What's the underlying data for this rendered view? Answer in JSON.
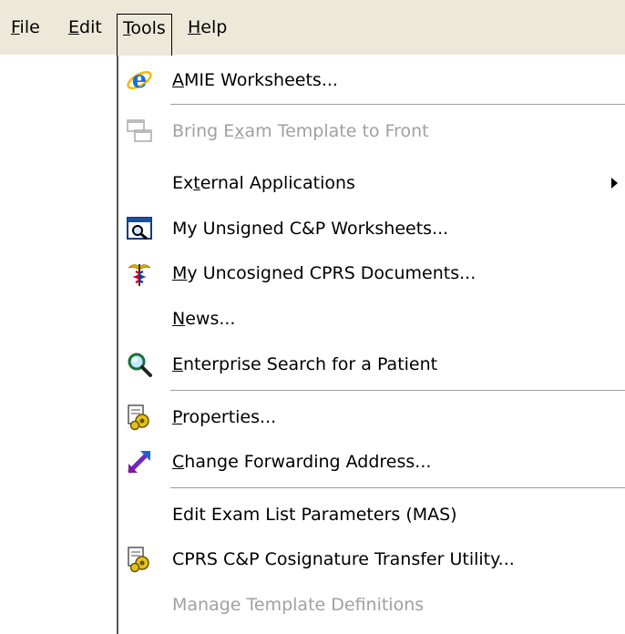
{
  "menubar": {
    "file": {
      "mnemonic": "F",
      "rest": "ile"
    },
    "edit": {
      "mnemonic": "E",
      "rest": "dit"
    },
    "tools": {
      "mnemonic": "T",
      "rest": "ools"
    },
    "help": {
      "mnemonic": "H",
      "rest": "elp"
    }
  },
  "tools_menu": {
    "items": [
      {
        "pre": "",
        "mnemonic": "A",
        "post": "MIE Worksheets...",
        "icon": "ie-icon",
        "enabled": true
      },
      {
        "pre": "Bring E",
        "mnemonic": "x",
        "post": "am Template to Front",
        "icon": "windows-icon",
        "enabled": false
      },
      {
        "pre": "Ex",
        "mnemonic": "t",
        "post": "ernal Applications",
        "icon": "",
        "enabled": true,
        "submenu": true
      },
      {
        "pre": "My Unsigned C&P Worksheets...",
        "mnemonic": "",
        "post": "",
        "icon": "magnifier-window-icon",
        "enabled": true
      },
      {
        "pre": "",
        "mnemonic": "M",
        "post": "y Uncosigned CPRS Documents...",
        "icon": "caduceus-icon",
        "enabled": true
      },
      {
        "pre": "",
        "mnemonic": "N",
        "post": "ews...",
        "icon": "",
        "enabled": true
      },
      {
        "pre": "",
        "mnemonic": "E",
        "post": "nterprise Search for a Patient",
        "icon": "search-icon",
        "enabled": true
      },
      {
        "pre": "",
        "mnemonic": "P",
        "post": "roperties...",
        "icon": "properties-gear-icon",
        "enabled": true
      },
      {
        "pre": "",
        "mnemonic": "C",
        "post": "hange Forwarding Address...",
        "icon": "forward-arrow-icon",
        "enabled": true
      },
      {
        "pre": "Edit Exam List Parameters (MAS)",
        "mnemonic": "",
        "post": "",
        "icon": "",
        "enabled": true
      },
      {
        "pre": "CPRS C&P Cosignature Transfer Utility...",
        "mnemonic": "",
        "post": "",
        "icon": "properties-gear-icon",
        "enabled": true
      },
      {
        "pre": "Manage Template Definitions",
        "mnemonic": "",
        "post": "",
        "icon": "",
        "enabled": false
      }
    ]
  },
  "colors": {
    "menubar_bg": "#ece9d8",
    "disabled_text": "#a0a0a0",
    "separator": "#a0a0a0"
  }
}
